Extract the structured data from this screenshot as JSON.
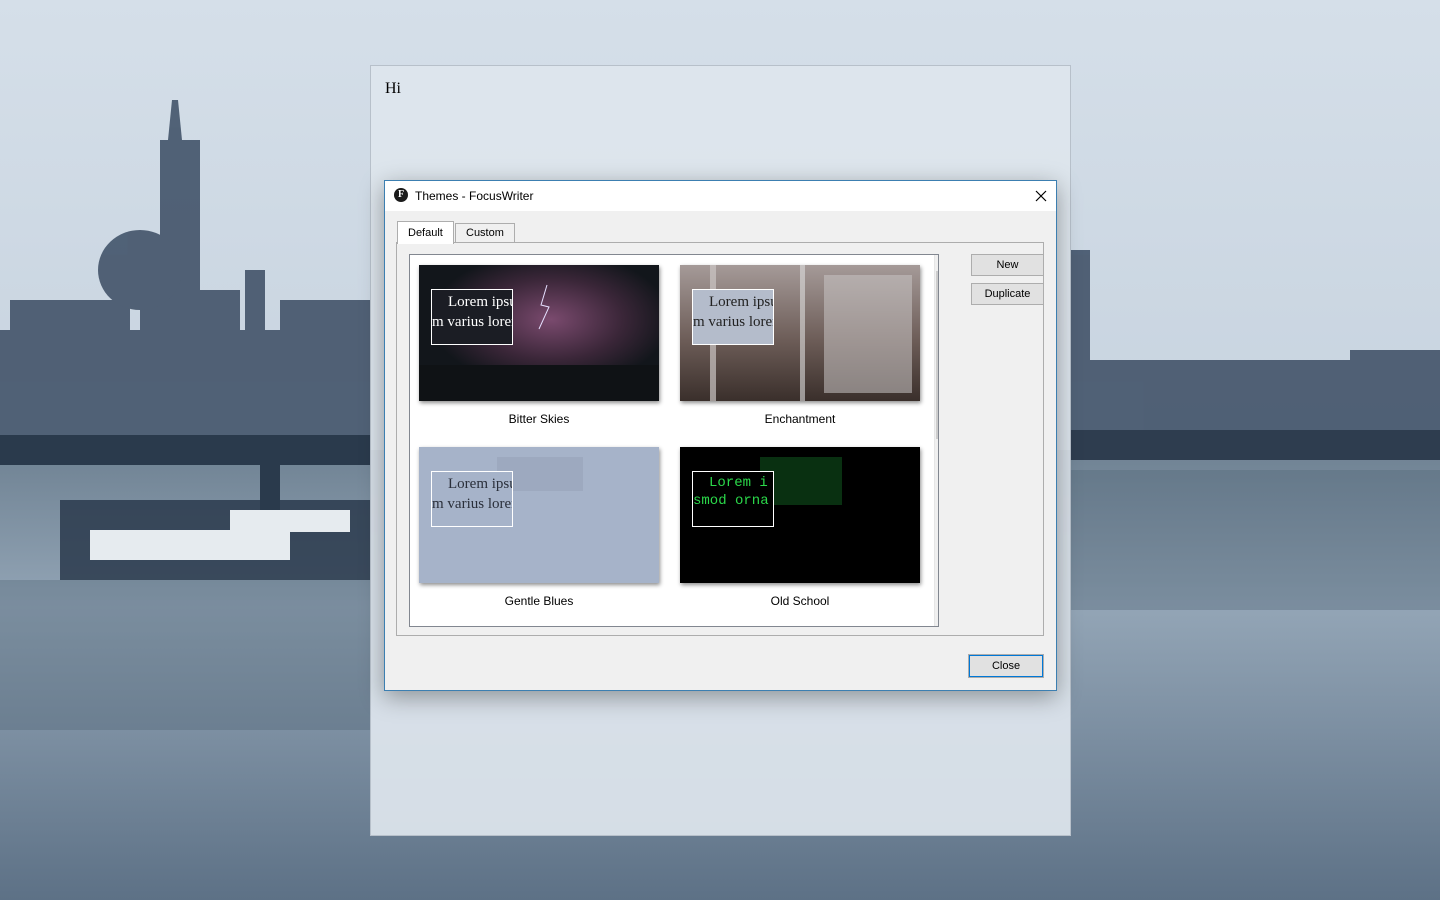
{
  "document": {
    "text": "Hi"
  },
  "dialog": {
    "title": "Themes - FocusWriter",
    "app_icon_glyph": "F",
    "tabs": [
      {
        "label": "Default",
        "active": true
      },
      {
        "label": "Custom",
        "active": false
      }
    ],
    "themes": [
      {
        "name": "Bitter Skies",
        "preview_line1": "Lorem ipsu",
        "preview_line2": "m varius lorem",
        "text_color": "#ffffff",
        "box_bg": "#1b1d24"
      },
      {
        "name": "Enchantment",
        "preview_line1": "Lorem ipsu",
        "preview_line2": "m varius lorem",
        "text_color": "#222222",
        "box_bg": "#b4bccb"
      },
      {
        "name": "Gentle Blues",
        "preview_line1": "Lorem ipsu",
        "preview_line2": "m varius lorem",
        "text_color": "#2a2f3a",
        "box_bg": "#a6b3c9"
      },
      {
        "name": "Old School",
        "preview_line1": "Lorem i",
        "preview_line2": "smod orna",
        "text_color": "#2bd84a",
        "box_bg": "#000000"
      }
    ],
    "buttons": {
      "new": "New",
      "duplicate": "Duplicate",
      "close": "Close"
    },
    "icons": {
      "close": "close-icon",
      "scroll_up": "scroll-up-arrow-icon",
      "scroll_down": "scroll-down-arrow-icon"
    },
    "colors": {
      "accent": "#0078d7",
      "border": "#3c7fb1"
    }
  }
}
